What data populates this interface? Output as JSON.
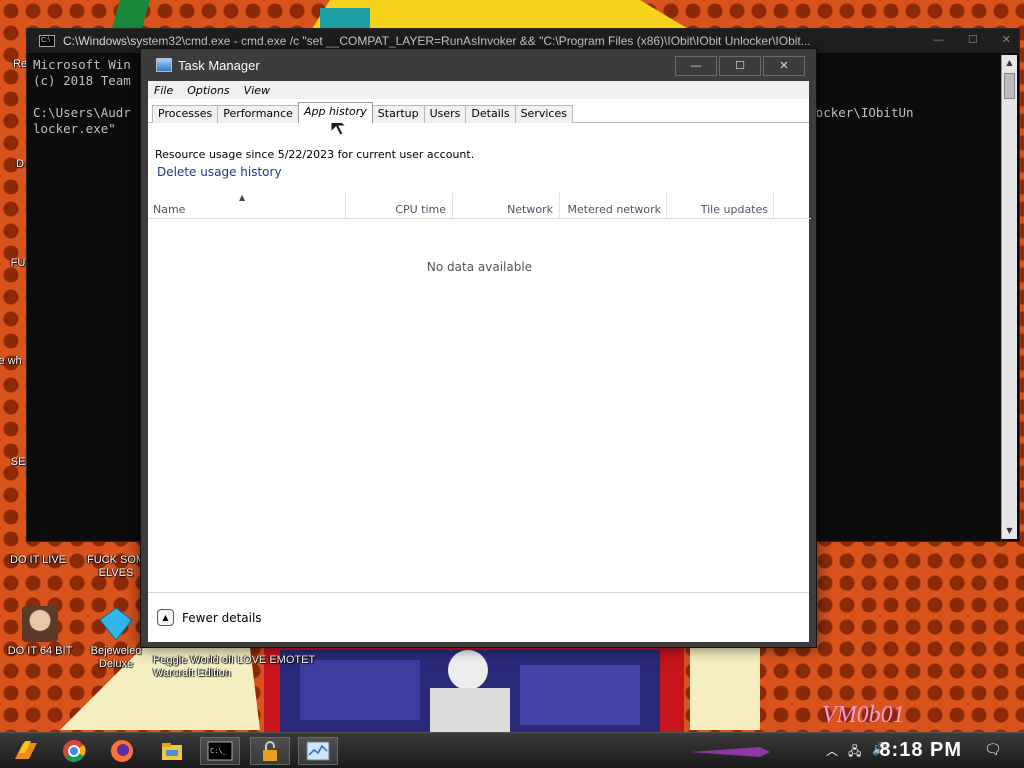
{
  "desktop": {
    "icons": [
      {
        "id": "recycle",
        "label": "Re"
      },
      {
        "id": "d",
        "label": "D"
      },
      {
        "id": "fu",
        "label": "FU"
      },
      {
        "id": "ne",
        "label": "ne wh"
      },
      {
        "id": "se",
        "label": "SE"
      },
      {
        "id": "doitlive",
        "label": "DO IT LIVE"
      },
      {
        "id": "fuckelves",
        "label": "FUCK SOM ELVES"
      },
      {
        "id": "doit64",
        "label": "DO IT 64 BIT"
      },
      {
        "id": "bejeweled",
        "label": "Bejeweled Deluxe"
      },
      {
        "id": "peggle",
        "label": "Peggle World of Warcraft Edition"
      },
      {
        "id": "emotet",
        "label": "I LOVE EMOTET"
      }
    ],
    "watermark": "VM0b01"
  },
  "cmd": {
    "title": "C:\\Windows\\system32\\cmd.exe - cmd.exe  /c \"set __COMPAT_LAYER=RunAsInvoker && \"C:\\Program Files (x86)\\IObit\\IObit Unlocker\\IObit...",
    "lines": [
      "Microsoft Win",
      "(c) 2018 Team",
      "",
      "C:\\Users\\Audr                                                                                  IObit Unlocker\\IObitUn",
      "locker.exe\""
    ]
  },
  "taskmanager": {
    "title": "Task Manager",
    "menu": [
      "File",
      "Options",
      "View"
    ],
    "tabs": [
      {
        "label": "Processes",
        "active": false
      },
      {
        "label": "Performance",
        "active": false
      },
      {
        "label": "App history",
        "active": true
      },
      {
        "label": "Startup",
        "active": false
      },
      {
        "label": "Users",
        "active": false
      },
      {
        "label": "Details",
        "active": false
      },
      {
        "label": "Services",
        "active": false
      }
    ],
    "resource_text": "Resource usage since 5/22/2023 for current user account.",
    "delete_link": "Delete usage history",
    "columns": [
      "Name",
      "CPU time",
      "Network",
      "Metered network",
      "Tile updates"
    ],
    "no_data": "No data available",
    "fewer_details": "Fewer details"
  },
  "taskbar": {
    "clock": "8:18 PM",
    "items": [
      "start-icon",
      "chrome-icon",
      "firefox-icon",
      "file-explorer-icon",
      "cmd-taskbar-icon",
      "lock-icon",
      "taskmanager-taskbar-icon"
    ]
  },
  "colors": {
    "desktop_bg": "#d9531c",
    "link": "#1a3b8a",
    "titlebar_dark": "#3c3c3c"
  }
}
